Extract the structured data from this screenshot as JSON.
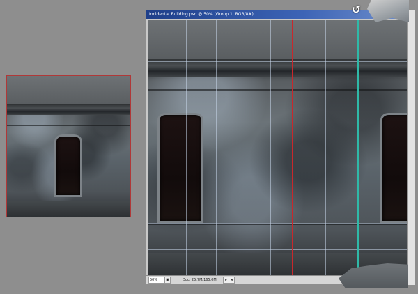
{
  "window": {
    "title": "Incidental Building.psd @ 50% (Group 1, RGB/8#)"
  },
  "status": {
    "zoom": "50%",
    "doc_info": "Doc: 25.7M/165.0M"
  },
  "colors": {
    "red_guide": "#c8282c",
    "cyan_guide": "#2fb9a8",
    "title_bar": "#1e3f8a",
    "workspace": "#8e8e8e"
  },
  "icons": {
    "cursor": "rotate-cursor-icon",
    "zoom_nav": "navigator-icon",
    "status_menu": "triangle-right-icon"
  }
}
